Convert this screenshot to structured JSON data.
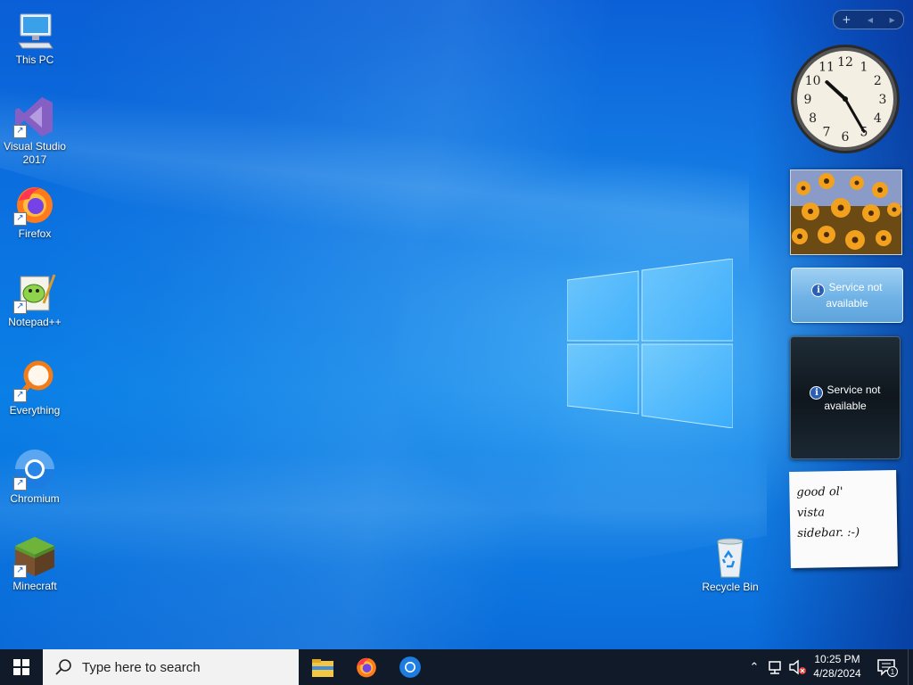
{
  "desktop": {
    "icons": [
      {
        "label": "This PC",
        "icon": "this-pc-icon",
        "shortcut": false
      },
      {
        "label": "Visual Studio 2017",
        "icon": "visual-studio-icon",
        "shortcut": true
      },
      {
        "label": "Firefox",
        "icon": "firefox-icon",
        "shortcut": true
      },
      {
        "label": "Notepad++",
        "icon": "notepad-plus-plus-icon",
        "shortcut": true
      },
      {
        "label": "Everything",
        "icon": "everything-search-icon",
        "shortcut": true
      },
      {
        "label": "Chromium",
        "icon": "chromium-icon",
        "shortcut": true
      },
      {
        "label": "Minecraft",
        "icon": "minecraft-icon",
        "shortcut": true
      }
    ],
    "recycle_bin": {
      "label": "Recycle Bin",
      "icon": "recycle-bin-icon"
    }
  },
  "sidebar": {
    "controls": {
      "add": "+",
      "prev": "◂",
      "next": "▸"
    },
    "clock": {
      "hour": 10,
      "minute": 25,
      "numbers": [
        "12",
        "1",
        "2",
        "3",
        "4",
        "5",
        "6",
        "7",
        "8",
        "9",
        "10",
        "11"
      ]
    },
    "gadget_light": {
      "message": "Service not available"
    },
    "gadget_dark": {
      "message": "Service not available"
    },
    "notes": {
      "text": "good ol'\nvista\nsidebar. :-)"
    }
  },
  "taskbar": {
    "search_placeholder": "Type here to search",
    "pinned_apps": [
      "file-explorer-icon",
      "firefox-icon",
      "chromium-icon"
    ],
    "time": "10:25 PM",
    "date": "4/28/2024",
    "notification_count": "1",
    "colors": {
      "taskbar_bg": "#101a28",
      "desktop_blue": "#0b72e0"
    }
  }
}
